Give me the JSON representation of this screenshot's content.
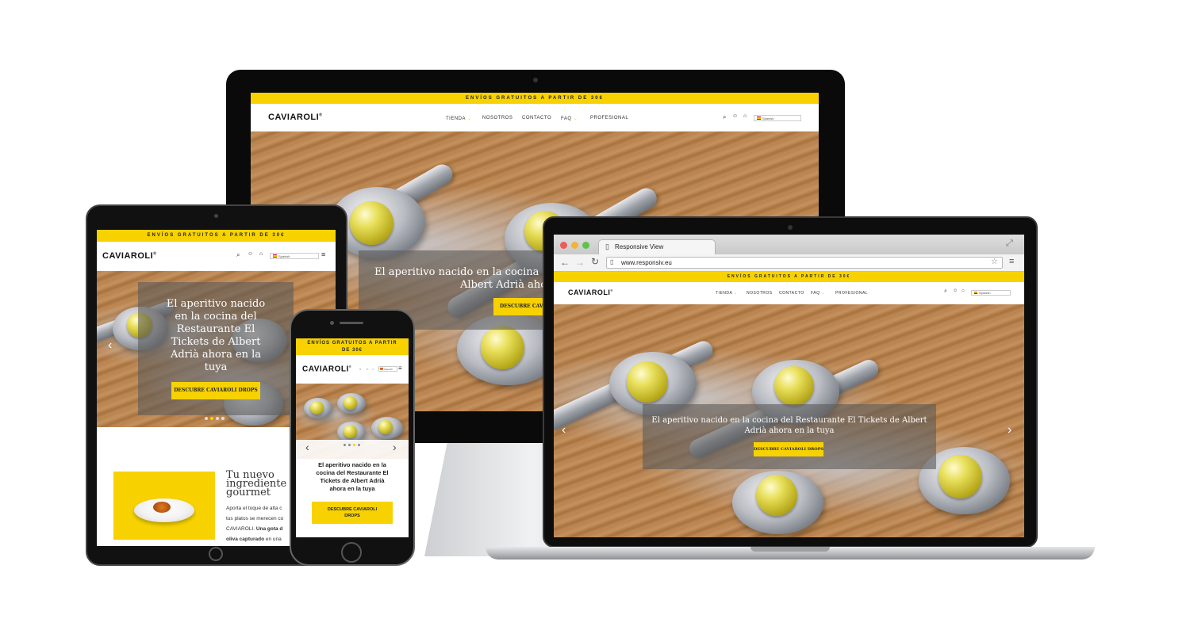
{
  "brand": {
    "logo": "CAVIAROLI",
    "registered": "®",
    "accent_color": "#f7d200"
  },
  "promo_bar": {
    "text": "ENVÍOS GRATUITOS A PARTIR DE 30€"
  },
  "nav": {
    "items": [
      "TIENDA",
      "NOSOTROS",
      "CONTACTO",
      "FAQ",
      "PROFESIONAL"
    ]
  },
  "language": {
    "selected": "Spanish"
  },
  "hero": {
    "headline": "El aperitivo nacido en la cocina del Restaurante El Tickets de Albert Adrià ahora en la tuya",
    "headline_partial_line1": "El aperitivo nacido en la cocina",
    "headline_partial_line2": "Albert Adrià ahora",
    "cta": "DESCUBRE CAVIAROLI DROPS",
    "cta_partial": "DESCUBRE CAVIA",
    "phone_cta_line1": "DESCUBRE CAVIAROLI",
    "phone_cta_line2": "DROPS"
  },
  "browser": {
    "tab_title": "Responsive View",
    "url": "www.responsiv.eu"
  },
  "ipad_section": {
    "title_line1": "Tu nuevo",
    "title_line2": "ingrediente",
    "title_line3": "gourmet",
    "body_line1": "Aporta el toque de alta c",
    "body_line2": "tus platos se merecen co",
    "body_line3_plain": "CAVIAROLI. ",
    "body_line3_bold": "Una gota d",
    "body_line4_bold": "oliva capturado",
    "body_line4_plain": " en una"
  },
  "ipad_hero": {
    "line1": "El aperitivo nacido",
    "line2": "en la cocina del",
    "line3": "Restaurante El",
    "line4": "Tickets de Albert",
    "line5": "Adrià ahora en la",
    "line6": "tuya"
  },
  "phone_hero": {
    "line1": "El aperitivo nacido en la",
    "line2": "cocina del Restaurante El",
    "line3": "Tickets de Albert Adrià",
    "line4": "ahora en la tuya"
  },
  "phone_promo": {
    "line1": "ENVÍOS GRATUITOS A PARTIR",
    "line2": "DE 30€"
  },
  "icons": [
    "search-icon",
    "user-icon",
    "cart-icon",
    "menu-icon",
    "chevron-left-icon",
    "chevron-right-icon",
    "back-icon",
    "forward-icon",
    "reload-icon",
    "star-icon",
    "expand-icon",
    "page-icon"
  ]
}
